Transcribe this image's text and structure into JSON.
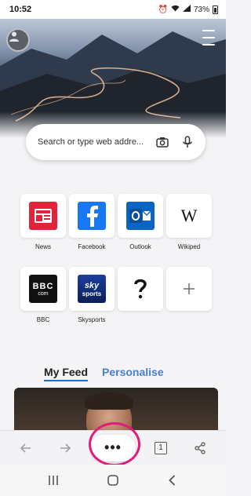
{
  "status_bar": {
    "time": "10:52",
    "battery": "73%"
  },
  "search": {
    "placeholder": "Search or type web addre..."
  },
  "speed_dial": [
    {
      "label": "News",
      "icon": "news-icon"
    },
    {
      "label": "Facebook",
      "icon": "facebook-icon"
    },
    {
      "label": "Outlook",
      "icon": "outlook-icon"
    },
    {
      "label": "Wikiped",
      "icon": "wikipedia-icon"
    },
    {
      "label": "BBC",
      "icon": "bbc-icon"
    },
    {
      "label": "Skysports",
      "icon": "skysports-icon"
    },
    {
      "label": "",
      "icon": "shortcut-icon"
    },
    {
      "label": "",
      "icon": "add-shortcut-icon"
    }
  ],
  "logos": {
    "bbc": "BBC",
    "bbc_sub": "com",
    "sky": "sky",
    "sports": "sports",
    "wiki": "W"
  },
  "news": {
    "tab_feed": "My Feed",
    "tab_personalise": "Personalise"
  },
  "toolbar": {
    "more_label": "•••",
    "tab_count": "1"
  },
  "colors": {
    "accent": "#1a73c8",
    "highlight_ring": "#e21b7b",
    "personalise": "#4a7fd0"
  }
}
